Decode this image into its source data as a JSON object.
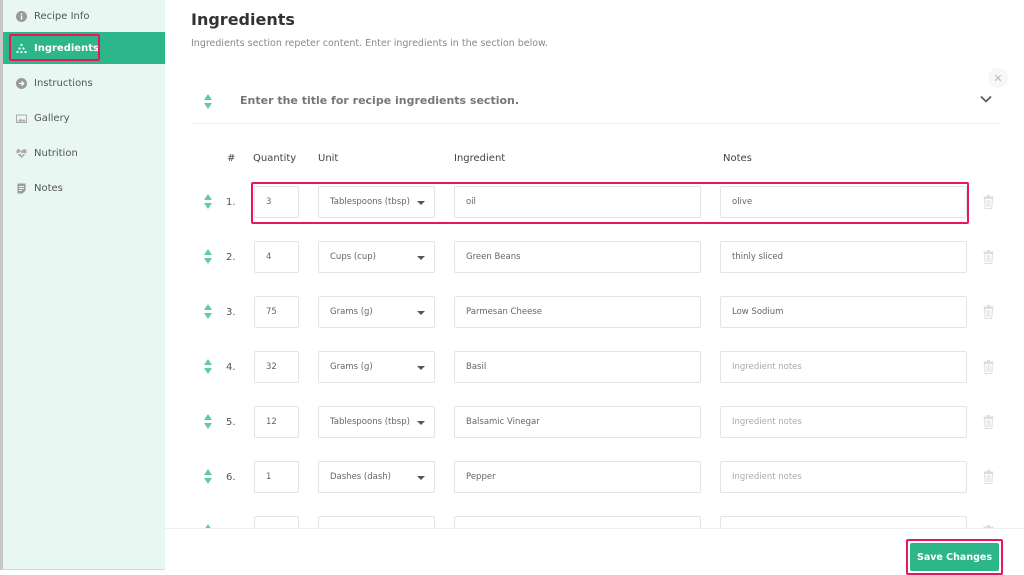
{
  "sidebar": {
    "items": [
      {
        "label": "Recipe Info",
        "icon": "info-icon",
        "active": false
      },
      {
        "label": "Ingredients",
        "icon": "ingredients-icon",
        "active": true
      },
      {
        "label": "Instructions",
        "icon": "arrow-circle-icon",
        "active": false
      },
      {
        "label": "Gallery",
        "icon": "image-icon",
        "active": false
      },
      {
        "label": "Nutrition",
        "icon": "heart-pulse-icon",
        "active": false
      },
      {
        "label": "Notes",
        "icon": "document-icon",
        "active": false
      }
    ]
  },
  "main": {
    "title": "Ingredients",
    "subtitle": "Ingredients section repeter content. Enter ingredients in the section below.",
    "section_title_placeholder": "Enter the title for recipe ingredients section.",
    "columns": {
      "num": "#",
      "quantity": "Quantity",
      "unit": "Unit",
      "ingredient": "Ingredient",
      "notes": "Notes"
    },
    "notes_placeholder": "Ingredient notes",
    "rows": [
      {
        "num": "1.",
        "quantity": "3",
        "unit": "Tablespoons (tbsp)",
        "ingredient": "oil",
        "notes": "olive"
      },
      {
        "num": "2.",
        "quantity": "4",
        "unit": "Cups (cup)",
        "ingredient": "Green Beans",
        "notes": "thinly sliced"
      },
      {
        "num": "3.",
        "quantity": "75",
        "unit": "Grams (g)",
        "ingredient": "Parmesan Cheese",
        "notes": "Low Sodium"
      },
      {
        "num": "4.",
        "quantity": "32",
        "unit": "Grams (g)",
        "ingredient": "Basil",
        "notes": ""
      },
      {
        "num": "5.",
        "quantity": "12",
        "unit": "Tablespoons (tbsp)",
        "ingredient": "Balsamic Vinegar",
        "notes": ""
      },
      {
        "num": "6.",
        "quantity": "1",
        "unit": "Dashes (dash)",
        "ingredient": "Pepper",
        "notes": ""
      },
      {
        "num": "",
        "quantity": "",
        "unit": "",
        "ingredient": "",
        "notes": ""
      }
    ]
  },
  "footer": {
    "save_label": "Save Changes"
  },
  "colors": {
    "accent": "#2db68a",
    "highlight": "#e8175d",
    "sidebar_bg": "#e8f7f2"
  }
}
